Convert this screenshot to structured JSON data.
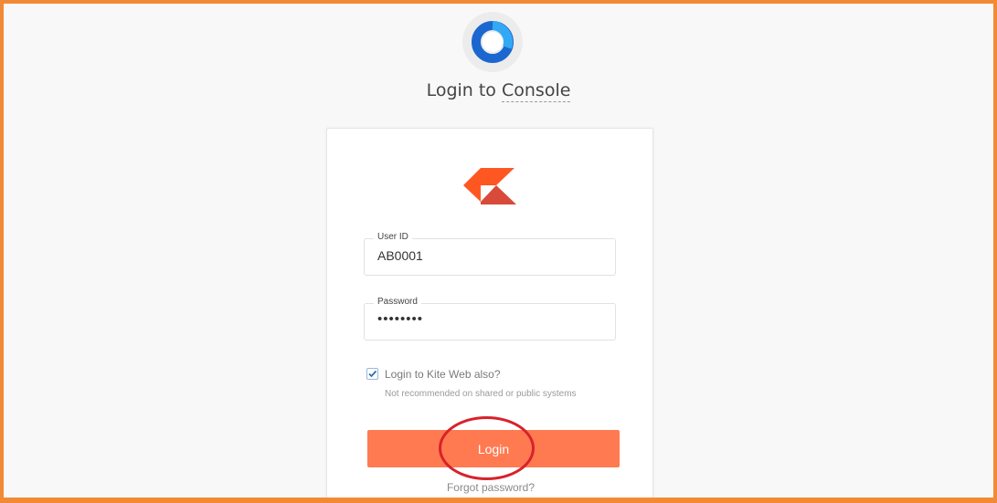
{
  "page": {
    "title_prefix": "Login to ",
    "title_emphasis": "Console"
  },
  "icons": {
    "console_logo": "console-ring-logo-icon",
    "kite_logo": "kite-logo-icon",
    "checkmark": "checkmark-icon"
  },
  "form": {
    "user_id": {
      "label": "User ID",
      "value": "AB0001"
    },
    "password": {
      "label": "Password",
      "value": "••••••••"
    },
    "kite_web": {
      "label": "Login to Kite Web also?",
      "hint": "Not recommended on shared or public systems",
      "checked": true
    },
    "login_label": "Login",
    "forgot_label": "Forgot password?"
  },
  "colors": {
    "frame_border": "#f28a35",
    "login_button": "#ff7a50",
    "kite_orange": "#ff5722",
    "kite_red": "#d84a3a",
    "console_blue": "#1b67cf",
    "annotation_red": "#d8222a"
  }
}
